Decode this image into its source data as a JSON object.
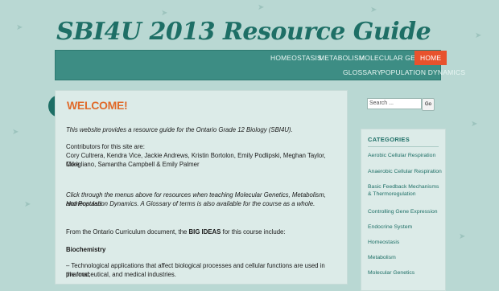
{
  "site": {
    "title": "SBI4U 2013 Resource Guide"
  },
  "nav": {
    "row1": [
      "HOMEOSTASIS",
      "METABOLISM",
      "MOLECULAR GENETICS",
      "HOME"
    ],
    "row2": [
      "GLOSSARY",
      "POPULATION DYNAMICS"
    ],
    "active": "HOME"
  },
  "main": {
    "title": "WELCOME!",
    "intro": "This website provides a resource guide for the Ontario Grade 12 Biology (SBI4U).",
    "contributors_label": "Contributors for this site are:",
    "contributors_l1": "Cory Cultrera, Kendra Vice, Jackie Andrews, Kristin Bortolon, Emily Podlipski, Meghan Taylor, Mike",
    "contributors_l2": "Corigliano, Samantha Campbell & Emily Palmer",
    "click_l1": "Click through the menus above for resources when teaching Molecular Genetics, Metabolism, Homeostasis",
    "click_l2": "and Population Dynamics.  A Glossary of terms is also available for the course as a whole.",
    "curriculum_pre": "From the Ontario Curriculum document, the ",
    "curriculum_bold": "BIG IDEAS",
    "curriculum_post": " for this course include:",
    "biochem_heading": "Biochemistry",
    "biochem_l1": "– Technological applications that affect biological processes and cellular functions are used in the food,",
    "biochem_l2": "pharmaceutical, and medical industries."
  },
  "search": {
    "placeholder": "Search ...",
    "button": "Go"
  },
  "categories": {
    "title": "CATEGORIES",
    "items": [
      "Aerobic Cellular Respiration",
      "Anaerobic Cellular Respiration",
      "Basic Feedback Mechanisms & Thermoregulation",
      "Controlling Gene Expression",
      "Endocrine System",
      "Homeostasis",
      "Metabolism",
      "Molecular Genetics"
    ]
  },
  "colors": {
    "accent": "#e8522d",
    "teal": "#1e6f66",
    "nav": "#3d8d84"
  }
}
